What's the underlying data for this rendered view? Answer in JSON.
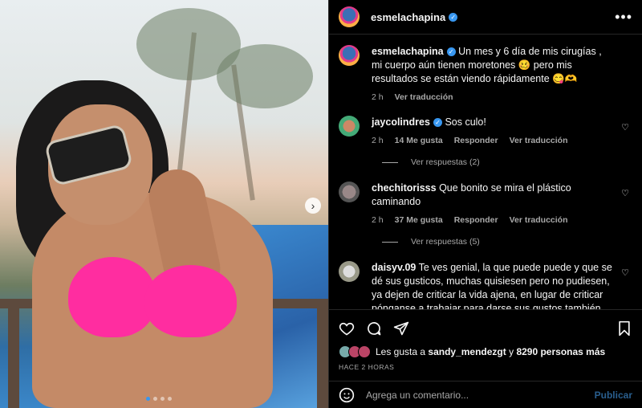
{
  "post": {
    "author": "esmelachapina",
    "caption_user": "esmelachapina",
    "caption": "Un mes y 6 día de mis cirugías , mi cuerpo aún tienen moretones 🥴 pero mis resultados se están viendo rápidamente 😋🫶",
    "caption_time": "2 h",
    "caption_translate": "Ver traducción",
    "more_icon": "more-horizontal-icon"
  },
  "comments": [
    {
      "user": "jaycolindres",
      "verified": true,
      "text": "Sos culo!",
      "time": "2 h",
      "likes": "14 Me gusta",
      "reply": "Responder",
      "translate": "Ver traducción",
      "replies": "Ver respuestas (2)"
    },
    {
      "user": "chechitorisss",
      "verified": false,
      "text": "Que bonito se mira el plástico caminando",
      "time": "2 h",
      "likes": "37 Me gusta",
      "reply": "Responder",
      "translate": "Ver traducción",
      "replies": "Ver respuestas (5)"
    },
    {
      "user": "daisyv.09",
      "verified": false,
      "text": "Te ves genial, la que puede puede y que se dé sus gusticos, muchas quisiesen pero no pudiesen, ya dejen de criticar la vida ajena, en lugar de criticar pónganse a trabajar para darse sus gustos también, porque si se enfocan en la vida de los demás, nunca se van a superar y van a seguir con su vida mediocre, cada"
    }
  ],
  "actions": {
    "likes_prefix": "Les gusta a",
    "likes_user": "sandy_mendezgt",
    "likes_mid": "y",
    "likes_count": "8290 personas más",
    "posted_ago": "HACE 2 HORAS"
  },
  "composer": {
    "placeholder": "Agrega un comentario...",
    "post_label": "Publicar"
  },
  "colors": {
    "accent": "#3897f0",
    "bikini": "#ff2da0",
    "background": "#000000"
  }
}
